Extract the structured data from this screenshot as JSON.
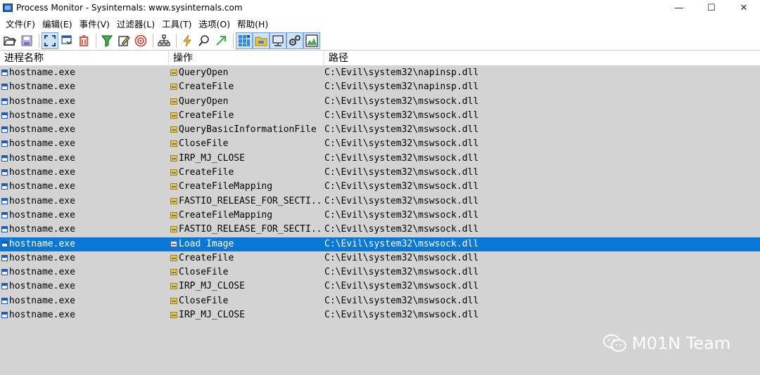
{
  "window": {
    "title": "Process Monitor - Sysinternals: www.sysinternals.com",
    "minimize": "—",
    "maximize": "☐",
    "close": "✕"
  },
  "menu": [
    "文件(F)",
    "编辑(E)",
    "事件(V)",
    "过滤器(L)",
    "工具(T)",
    "选项(O)",
    "帮助(H)"
  ],
  "toolbar": {
    "icons": [
      "open-icon",
      "save-icon",
      "autoscroll-icon",
      "clear-display-icon",
      "delete-icon",
      "filter-icon",
      "highlight-icon",
      "target-icon",
      "process-tree-icon",
      "lightning-icon",
      "find-icon",
      "jump-icon",
      "registry-icon",
      "filesystem-icon",
      "network-icon",
      "process-thread-icon",
      "profiling-icon"
    ],
    "pressed": [
      "registry-icon",
      "filesystem-icon",
      "network-icon",
      "process-thread-icon",
      "profiling-icon"
    ]
  },
  "columns": {
    "process": "进程名称",
    "operation": "操作",
    "path": "路径"
  },
  "rows": [
    {
      "process": "hostname.exe",
      "operation": "QueryOpen",
      "path": "C:\\Evil\\system32\\napinsp.dll",
      "selected": false
    },
    {
      "process": "hostname.exe",
      "operation": "CreateFile",
      "path": "C:\\Evil\\system32\\napinsp.dll",
      "selected": false
    },
    {
      "process": "hostname.exe",
      "operation": "QueryOpen",
      "path": "C:\\Evil\\system32\\mswsock.dll",
      "selected": false
    },
    {
      "process": "hostname.exe",
      "operation": "CreateFile",
      "path": "C:\\Evil\\system32\\mswsock.dll",
      "selected": false
    },
    {
      "process": "hostname.exe",
      "operation": "QueryBasicInformationFile",
      "path": "C:\\Evil\\system32\\mswsock.dll",
      "selected": false
    },
    {
      "process": "hostname.exe",
      "operation": "CloseFile",
      "path": "C:\\Evil\\system32\\mswsock.dll",
      "selected": false
    },
    {
      "process": "hostname.exe",
      "operation": "IRP_MJ_CLOSE",
      "path": "C:\\Evil\\system32\\mswsock.dll",
      "selected": false
    },
    {
      "process": "hostname.exe",
      "operation": "CreateFile",
      "path": "C:\\Evil\\system32\\mswsock.dll",
      "selected": false
    },
    {
      "process": "hostname.exe",
      "operation": "CreateFileMapping",
      "path": "C:\\Evil\\system32\\mswsock.dll",
      "selected": false
    },
    {
      "process": "hostname.exe",
      "operation": "FASTIO_RELEASE_FOR_SECTI...",
      "path": "C:\\Evil\\system32\\mswsock.dll",
      "selected": false
    },
    {
      "process": "hostname.exe",
      "operation": "CreateFileMapping",
      "path": "C:\\Evil\\system32\\mswsock.dll",
      "selected": false
    },
    {
      "process": "hostname.exe",
      "operation": "FASTIO_RELEASE_FOR_SECTI...",
      "path": "C:\\Evil\\system32\\mswsock.dll",
      "selected": false
    },
    {
      "process": "hostname.exe",
      "operation": "Load Image",
      "path": "C:\\Evil\\system32\\mswsock.dll",
      "selected": true
    },
    {
      "process": "hostname.exe",
      "operation": "CreateFile",
      "path": "C:\\Evil\\system32\\mswsock.dll",
      "selected": false
    },
    {
      "process": "hostname.exe",
      "operation": "CloseFile",
      "path": "C:\\Evil\\system32\\mswsock.dll",
      "selected": false
    },
    {
      "process": "hostname.exe",
      "operation": "IRP_MJ_CLOSE",
      "path": "C:\\Evil\\system32\\mswsock.dll",
      "selected": false
    },
    {
      "process": "hostname.exe",
      "operation": "CloseFile",
      "path": "C:\\Evil\\system32\\mswsock.dll",
      "selected": false
    },
    {
      "process": "hostname.exe",
      "operation": "IRP_MJ_CLOSE",
      "path": "C:\\Evil\\system32\\mswsock.dll",
      "selected": false
    }
  ],
  "watermark": {
    "text": "M01N Team",
    "icon": "wechat-icon"
  },
  "colors": {
    "selection": "#0a78d7",
    "list_background": "#d3d3d3"
  }
}
